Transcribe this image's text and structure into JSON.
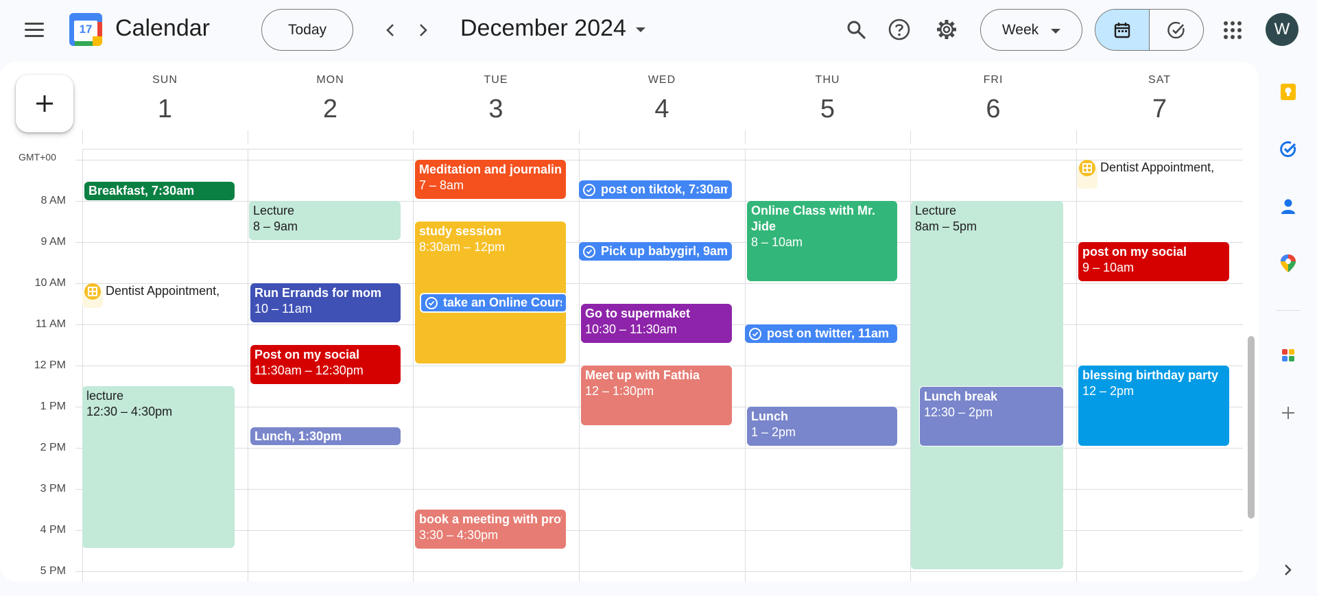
{
  "header": {
    "app_title": "Calendar",
    "logo_number": "17",
    "today_label": "Today",
    "month_label": "December 2024",
    "view_label": "Week",
    "avatar_initial": "W"
  },
  "days": [
    {
      "name": "SUN",
      "num": "1"
    },
    {
      "name": "MON",
      "num": "2"
    },
    {
      "name": "TUE",
      "num": "3"
    },
    {
      "name": "WED",
      "num": "4"
    },
    {
      "name": "THU",
      "num": "5"
    },
    {
      "name": "FRI",
      "num": "6"
    },
    {
      "name": "SAT",
      "num": "7"
    }
  ],
  "timezone": "GMT+00",
  "hours": [
    "8 AM",
    "9 AM",
    "10 AM",
    "11 AM",
    "12 PM",
    "1 PM",
    "2 PM",
    "3 PM",
    "4 PM",
    "5 PM"
  ],
  "events": {
    "sun_breakfast": {
      "title": "Breakfast, 7:30am"
    },
    "sun_dentist": {
      "title": "Dentist Appointment,"
    },
    "sun_lecture": {
      "title": "lecture",
      "time": "12:30 – 4:30pm"
    },
    "mon_lecture": {
      "title": "Lecture",
      "time": "8 – 9am"
    },
    "mon_errands": {
      "title": "Run Errands for mom",
      "time": "10 – 11am"
    },
    "mon_post": {
      "title": "Post on my social",
      "time": "11:30am – 12:30pm"
    },
    "mon_lunch": {
      "title": "Lunch, 1:30pm"
    },
    "tue_meditation": {
      "title": "Meditation and journaling",
      "time": "7 – 8am"
    },
    "tue_study": {
      "title": "study session",
      "time": "8:30am – 12pm"
    },
    "tue_online_course": {
      "title": "take an Online Course"
    },
    "tue_meeting": {
      "title": "book a meeting with prof",
      "time": "3:30 – 4:30pm"
    },
    "wed_tiktok": {
      "title": "post on tiktok, 7:30am"
    },
    "wed_babygirl": {
      "title": "Pick up babygirl, 9am"
    },
    "wed_supermarket": {
      "title": "Go to supermaket",
      "time": "10:30 – 11:30am"
    },
    "wed_fathia": {
      "title": "Meet up with Fathia",
      "time": "12 – 1:30pm"
    },
    "thu_online_class": {
      "title": "Online Class with Mr. Jide",
      "time": "8 – 10am"
    },
    "thu_twitter": {
      "title": "post on twitter, 11am"
    },
    "thu_lunch": {
      "title": "Lunch",
      "time": "1 – 2pm"
    },
    "fri_lecture": {
      "title": "Lecture",
      "time": "8am – 5pm"
    },
    "fri_lunch_break": {
      "title": "Lunch break",
      "time": "12:30 – 2pm"
    },
    "sat_dentist": {
      "title": "Dentist Appointment,"
    },
    "sat_post": {
      "title": "post on my social",
      "time": "9 – 10am"
    },
    "sat_birthday": {
      "title": "blessing birthday party",
      "time": "12 – 2pm"
    }
  },
  "colors": {
    "sage": "#c3e9d9",
    "green_dark": "#0b8043",
    "green": "#33b679",
    "tangerine": "#f4511e",
    "banana": "#f6bf26",
    "blueberry": "#3f51b5",
    "tomato": "#d50000",
    "lavender": "#7986cb",
    "flamingo": "#e67c73",
    "grape": "#8e24aa",
    "peacock": "#039be5",
    "task_blue": "#4285f4"
  }
}
